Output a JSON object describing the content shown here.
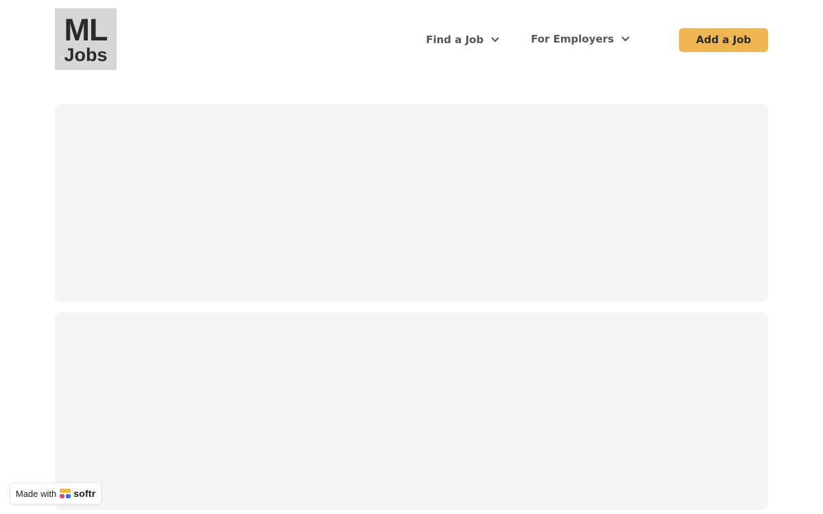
{
  "header": {
    "logo": {
      "line1": "ML",
      "line2": "Jobs"
    },
    "nav": [
      {
        "label": "Find a Job"
      },
      {
        "label": "For Employers"
      }
    ],
    "cta_label": "Add a Job"
  },
  "colors": {
    "cta_background": "#f0b650",
    "logo_background": "#d6d6d6",
    "placeholder_background": "#f5f5f5",
    "nav_text": "#555555"
  },
  "badge": {
    "prefix": "Made with",
    "brand": "softr"
  },
  "icons": {
    "nav_chevron": "chevron-down-icon",
    "badge_logo": "softr-logo-icon"
  }
}
